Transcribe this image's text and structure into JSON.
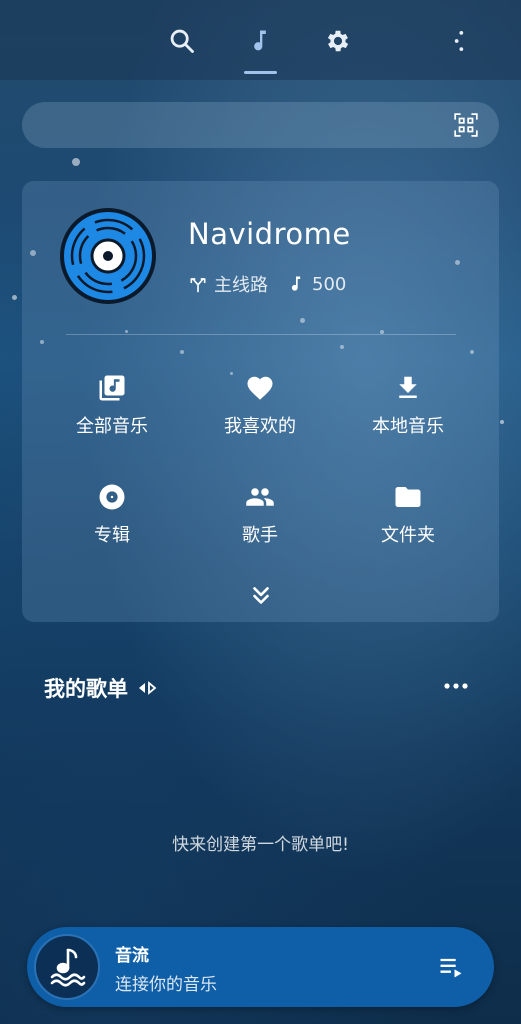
{
  "topbar": {
    "tabs": [
      {
        "icon": "search-icon"
      },
      {
        "icon": "music-note-icon",
        "active": true
      },
      {
        "icon": "gear-icon"
      }
    ],
    "menu_icon": "more-vertical-icon"
  },
  "search": {
    "placeholder": "",
    "scan_icon": "qr-scan-icon"
  },
  "server": {
    "name": "Navidrome",
    "route": "主线路",
    "song_count": "500"
  },
  "library": {
    "items": [
      {
        "label": "全部音乐",
        "icon": "music-library-icon"
      },
      {
        "label": "我喜欢的",
        "icon": "heart-icon"
      },
      {
        "label": "本地音乐",
        "icon": "download-icon"
      },
      {
        "label": "专辑",
        "icon": "album-icon"
      },
      {
        "label": "歌手",
        "icon": "people-icon"
      },
      {
        "label": "文件夹",
        "icon": "folder-icon"
      }
    ],
    "expand_icon": "double-chevron-down-icon"
  },
  "playlists": {
    "title": "我的歌单",
    "empty_message": "快来创建第一个歌单吧!"
  },
  "player": {
    "title": "音流",
    "subtitle": "连接你的音乐"
  },
  "colors": {
    "accent": "#9fc3ea",
    "player_bg": "#0f5ea8",
    "disc_blue": "#1e88e5"
  }
}
